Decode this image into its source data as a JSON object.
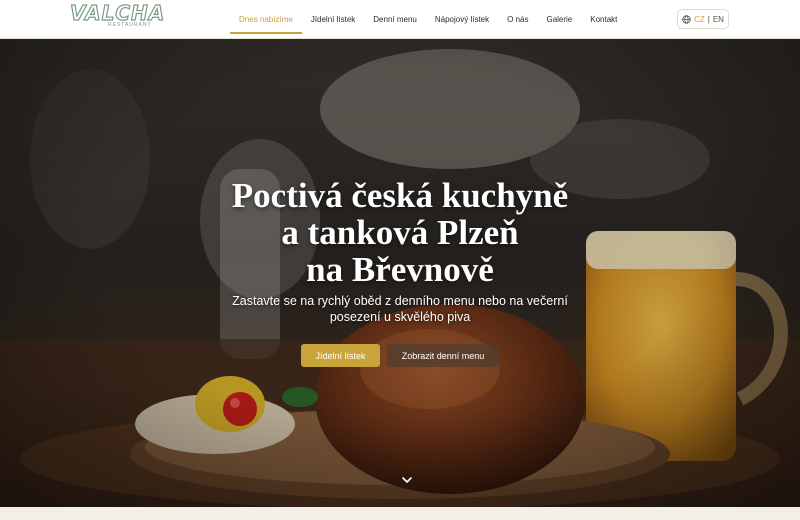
{
  "brand": {
    "name": "VALCHA",
    "subtitle": "RESTAURANT"
  },
  "nav": {
    "items": [
      {
        "label": "Dnes nabízíme",
        "active": true
      },
      {
        "label": "Jídelní lístek"
      },
      {
        "label": "Denní menu"
      },
      {
        "label": "Nápojový lístek"
      },
      {
        "label": "O nás"
      },
      {
        "label": "Galerie"
      },
      {
        "label": "Kontakt"
      }
    ]
  },
  "language": {
    "icon": "globe-icon",
    "current": "CZ",
    "separator": "|",
    "other": "EN"
  },
  "hero": {
    "title_line1": "Poctivá česká kuchyně",
    "title_line2": "a tanková Plzeň",
    "title_line3": "na Břevnově",
    "subtitle": "Zastavte se na rychlý oběd z denního menu nebo na večerní posezení u skvělého piva",
    "primary_button": "Jídelní lístek",
    "secondary_button": "Zobrazit denní menu",
    "scroll_icon": "chevron-down-icon"
  },
  "colors": {
    "accent": "#c9a43b",
    "logo": "#7a9a83",
    "header_bg": "#ffffff"
  }
}
